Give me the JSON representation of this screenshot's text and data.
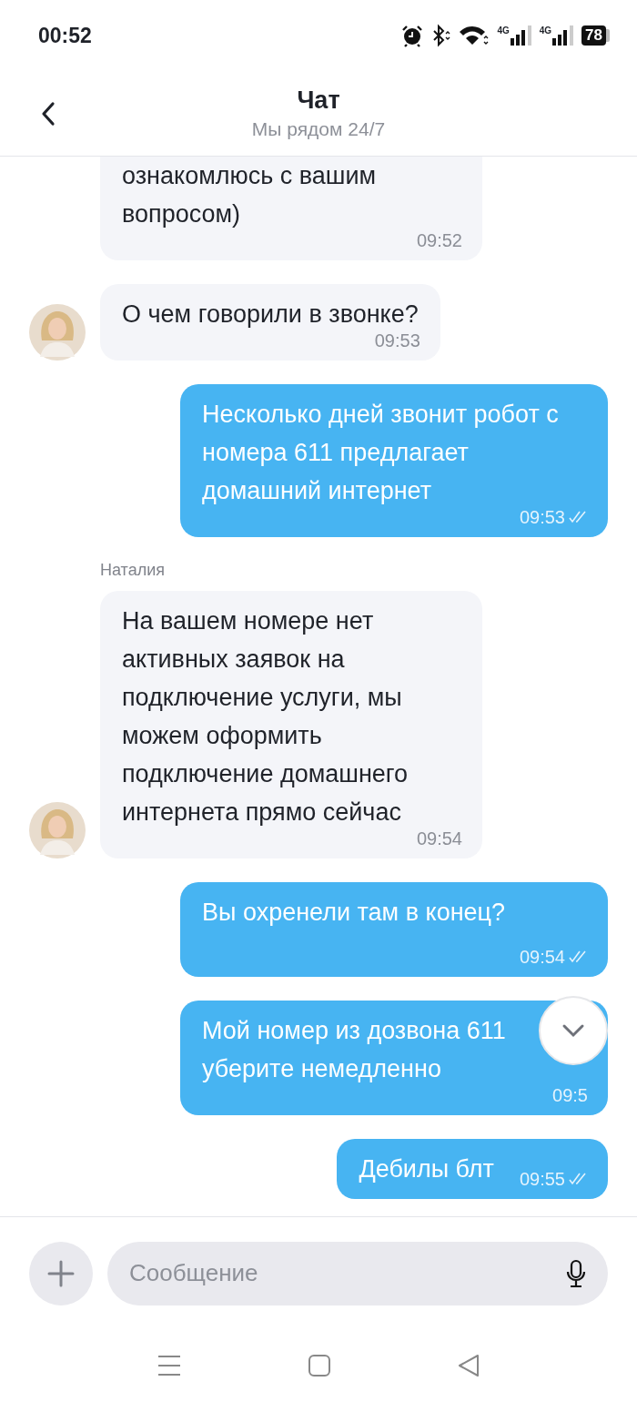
{
  "status_bar": {
    "time": "00:52",
    "network_labels": [
      "4G",
      "4G"
    ],
    "battery": "78"
  },
  "header": {
    "title": "Чат",
    "subtitle": "Мы рядом 24/7"
  },
  "messages": [
    {
      "kind": "incoming",
      "text": "ознакомлюсь с вашим вопросом)",
      "time": "09:52",
      "avatar": false
    },
    {
      "kind": "incoming",
      "text": "О чем говорили в звонке?",
      "time": "09:53",
      "avatar": true
    },
    {
      "kind": "outgoing",
      "text": "Несколько дней звонит робот с номера 611 предлагает домашний интернет",
      "time": "09:53",
      "read": true
    },
    {
      "kind": "incoming",
      "sender": "Наталия",
      "text": "На вашем номере нет активных заявок на подключение услуги, мы можем оформить подключение домашнего интернета прямо сейчас",
      "time": "09:54",
      "avatar": true
    },
    {
      "kind": "outgoing",
      "text": "Вы охренели там в конец?",
      "time": "09:54",
      "read": true
    },
    {
      "kind": "outgoing",
      "text": "Мой номер из дозвона 611 уберите немедленно",
      "time": "09:5",
      "read": false
    },
    {
      "kind": "outgoing",
      "text": "Дебилы блт",
      "time": "09:55",
      "read": true
    }
  ],
  "composer": {
    "placeholder": "Сообщение"
  }
}
